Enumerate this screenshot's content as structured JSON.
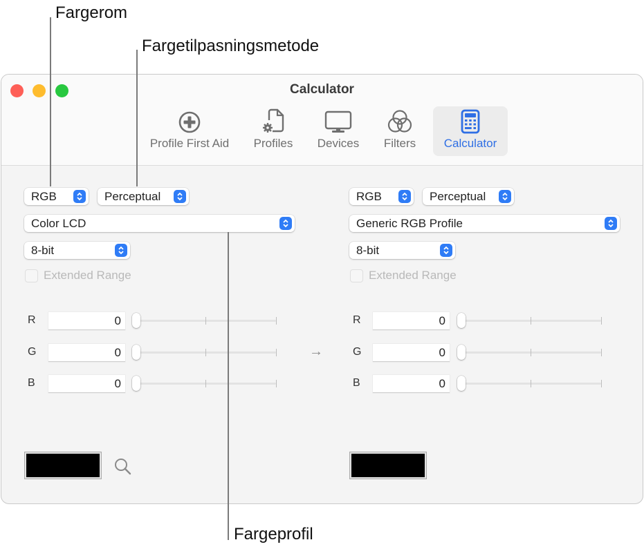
{
  "callouts": {
    "color_space": "Fargerom",
    "rendering_intent": "Fargetilpasningsmetode",
    "color_profile": "Fargeprofil"
  },
  "window": {
    "title": "Calculator",
    "traffic_lights": {
      "close": "#fe5f57",
      "minimize": "#febc2e",
      "maximize": "#28c840"
    }
  },
  "toolbar": {
    "items": [
      {
        "label": "Profile First Aid",
        "icon": "plus-circle-icon",
        "active": false
      },
      {
        "label": "Profiles",
        "icon": "document-gear-icon",
        "active": false
      },
      {
        "label": "Devices",
        "icon": "display-icon",
        "active": false
      },
      {
        "label": "Filters",
        "icon": "overlapping-circles-icon",
        "active": false
      },
      {
        "label": "Calculator",
        "icon": "calculator-icon",
        "active": true
      }
    ],
    "accent": "#2f6fe4"
  },
  "source": {
    "color_space": "RGB",
    "intent": "Perceptual",
    "profile": "Color LCD",
    "depth": "8-bit",
    "extended_range_label": "Extended Range",
    "extended_range_checked": false,
    "channels": [
      {
        "label": "R",
        "value": "0",
        "slider_fraction": 0
      },
      {
        "label": "G",
        "value": "0",
        "slider_fraction": 0
      },
      {
        "label": "B",
        "value": "0",
        "slider_fraction": 0
      }
    ],
    "swatch_color": "#000000",
    "eyedropper_icon": "magnifier-icon"
  },
  "arrow": "→",
  "destination": {
    "color_space": "RGB",
    "intent": "Perceptual",
    "profile": "Generic RGB Profile",
    "depth": "8-bit",
    "extended_range_label": "Extended Range",
    "extended_range_checked": false,
    "channels": [
      {
        "label": "R",
        "value": "0",
        "slider_fraction": 0
      },
      {
        "label": "G",
        "value": "0",
        "slider_fraction": 0
      },
      {
        "label": "B",
        "value": "0",
        "slider_fraction": 0
      }
    ],
    "swatch_color": "#000000"
  }
}
